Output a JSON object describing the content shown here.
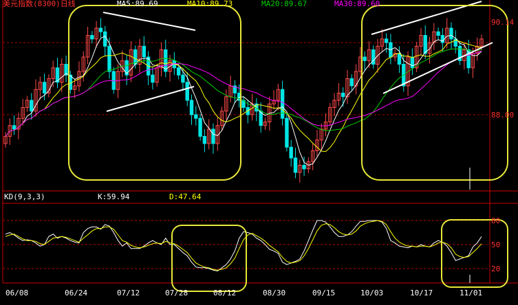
{
  "header": {
    "title": "美元指数(8300)日线",
    "ma5": "MA5:89.69",
    "ma10": "MA10:89.73",
    "ma20": "MA20:89.67",
    "ma30": "MA30:89.60"
  },
  "right_axis": {
    "top_value": "90.14",
    "mid_value": "88.00"
  },
  "kd_header": {
    "name": "KD(9,3,3)",
    "k": "K:59.94",
    "d": "D:47.64"
  },
  "kd_axis": [
    "80",
    "50",
    "20"
  ],
  "date_axis": [
    "06/08",
    "06/24",
    "07/12",
    "07/28",
    "08/12",
    "08/30",
    "09/15",
    "10/03",
    "10/17",
    "11/01"
  ],
  "colors": {
    "up": "#ff4a4a",
    "down": "#00e5e5",
    "ma5": "#ffffff",
    "ma10": "#ffff00",
    "ma20": "#00cc00",
    "ma30": "#ff00ff",
    "highlight": "#e8e838",
    "trendline": "#ffffff",
    "grid": "#b00000",
    "axis": "#cc0000",
    "text_red": "#ff3030"
  },
  "chart_data": {
    "type": "candlestick",
    "title": "美元指数(8300)日线",
    "x_dates": [
      "06/08",
      "06/24",
      "07/12",
      "07/28",
      "08/12",
      "08/30",
      "09/15",
      "10/03",
      "10/17",
      "11/01"
    ],
    "price_levels": [
      88.0,
      90.14
    ],
    "close": [
      87.4,
      87.7,
      87.6,
      87.9,
      88.2,
      88.4,
      88.1,
      88.7,
      88.9,
      88.6,
      89.0,
      89.3,
      88.9,
      89.4,
      89.1,
      88.7,
      88.8,
      89.2,
      89.6,
      90.2,
      90.1,
      90.4,
      90.3,
      89.9,
      89.2,
      88.7,
      89.2,
      89.5,
      89.1,
      89.8,
      89.4,
      89.9,
      89.6,
      89.1,
      88.9,
      89.3,
      89.8,
      89.2,
      89.5,
      89.3,
      89.1,
      88.9,
      88.4,
      88.0,
      87.9,
      87.4,
      87.2,
      87.6,
      87.2,
      87.7,
      88.1,
      88.5,
      88.8,
      88.6,
      88.4,
      88.2,
      88.0,
      88.3,
      88.1,
      87.7,
      87.8,
      88.3,
      88.4,
      88.7,
      87.9,
      87.1,
      86.8,
      86.4,
      86.6,
      86.5,
      86.7,
      87.0,
      87.3,
      87.6,
      87.8,
      88.2,
      88.4,
      88.6,
      88.5,
      89.0,
      88.8,
      89.2,
      89.6,
      89.5,
      89.8,
      89.4,
      89.9,
      90.1,
      90.0,
      89.6,
      89.7,
      89.4,
      88.8,
      89.6,
      89.3,
      89.9,
      90.2,
      89.7,
      90.0,
      90.3,
      90.2,
      90.0,
      90.4,
      90.1,
      89.9,
      89.5,
      89.8,
      89.3,
      89.7,
      89.9,
      90.1
    ],
    "kd": {
      "k": [
        63,
        65,
        62,
        58,
        55,
        56,
        55,
        52,
        48,
        50,
        60,
        63,
        58,
        60,
        58,
        55,
        53,
        52,
        65,
        70,
        72,
        72,
        69,
        75,
        73,
        65,
        55,
        48,
        52,
        45,
        45,
        45,
        48,
        52,
        55,
        52,
        50,
        58,
        50,
        50,
        45,
        40,
        36,
        28,
        22,
        21,
        21,
        20,
        18,
        17,
        21,
        25,
        32,
        42,
        58,
        66,
        65,
        63,
        58,
        55,
        50,
        44,
        42,
        39,
        28,
        25,
        27,
        29,
        32,
        42,
        55,
        68,
        80,
        80,
        78,
        72,
        65,
        60,
        60,
        62,
        66,
        73,
        79,
        79,
        80,
        80,
        80,
        78,
        70,
        55,
        52,
        48,
        47,
        46,
        48,
        47,
        50,
        48,
        47,
        52,
        55,
        53,
        48,
        40,
        30,
        32,
        34,
        36,
        47,
        52,
        60
      ],
      "d": [
        60,
        62,
        63,
        60,
        57,
        55,
        55,
        54,
        51,
        50,
        54,
        58,
        59,
        60,
        59,
        57,
        55,
        53,
        58,
        62,
        67,
        70,
        70,
        72,
        72,
        69,
        62,
        55,
        53,
        49,
        47,
        46,
        47,
        49,
        51,
        52,
        51,
        54,
        52,
        51,
        48,
        44,
        40,
        33,
        27,
        24,
        22,
        21,
        19,
        18,
        19,
        21,
        26,
        33,
        45,
        56,
        62,
        64,
        61,
        58,
        54,
        49,
        45,
        41,
        34,
        29,
        27,
        28,
        30,
        36,
        45,
        56,
        67,
        74,
        76,
        75,
        71,
        66,
        63,
        62,
        63,
        67,
        73,
        76,
        78,
        79,
        80,
        79,
        75,
        66,
        58,
        53,
        50,
        48,
        48,
        47,
        48,
        48,
        47,
        49,
        52,
        53,
        51,
        46,
        38,
        35,
        34,
        35,
        40,
        45,
        51
      ]
    },
    "annotations": [
      "triangle-consolidation-jun-jul",
      "kd-oversold-aug",
      "rising-wedge-oct",
      "kd-cross-nov"
    ]
  }
}
